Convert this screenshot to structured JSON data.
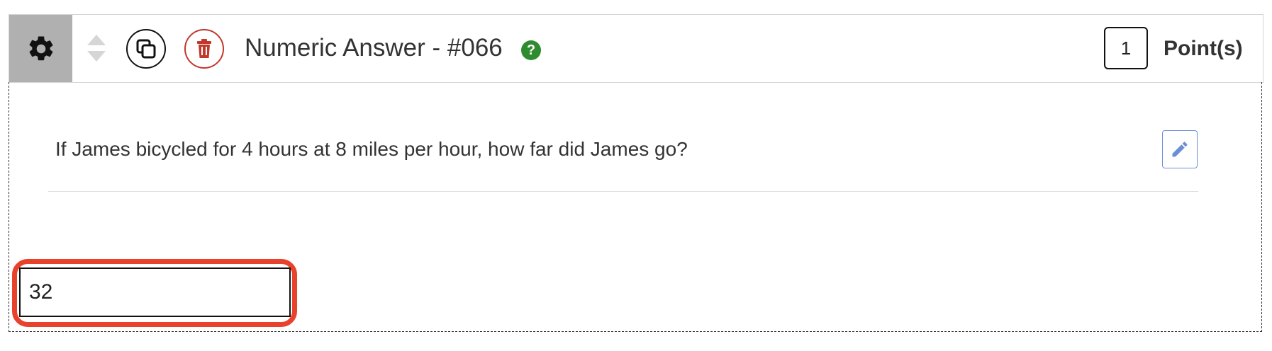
{
  "header": {
    "title": "Numeric Answer - #066",
    "help_symbol": "?",
    "points_value": "1",
    "points_label": "Point(s)",
    "icons": {
      "settings": "gear-icon",
      "reorder": "sort-arrows-icon",
      "copy": "copy-icon",
      "delete": "trash-icon",
      "help": "question-circle-icon",
      "edit": "pencil-icon"
    }
  },
  "question": {
    "text": "If James bicycled for 4 hours at 8 miles per hour, how far did James go?"
  },
  "answer": {
    "value": "32"
  },
  "colors": {
    "settings_bg": "#b0b0b0",
    "delete_accent": "#c0392b",
    "help_green": "#2e8b2e",
    "edit_blue": "#6b8fd6",
    "highlight_red": "#e8412c"
  }
}
